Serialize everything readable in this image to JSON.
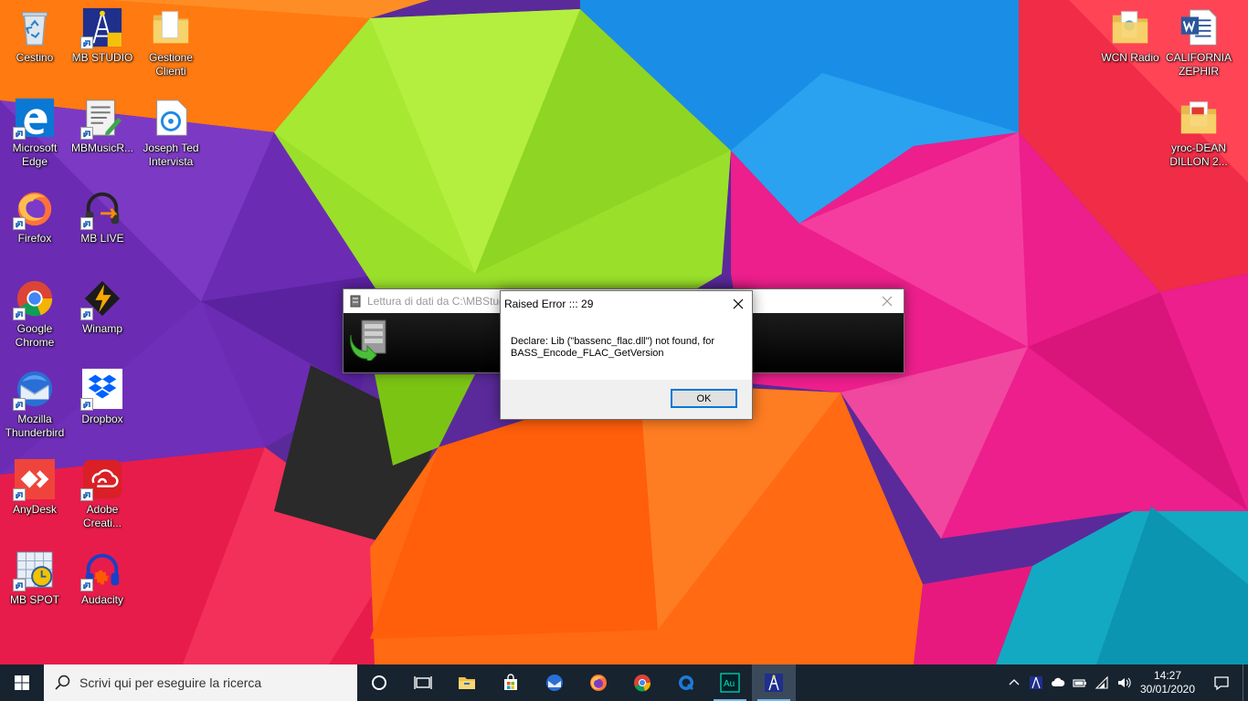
{
  "desktop": {
    "left_icons": [
      {
        "label": "Cestino",
        "icon": "recycle-bin-icon",
        "shortcut": false
      },
      {
        "label": "MB STUDIO",
        "icon": "mb-studio-icon",
        "shortcut": true
      },
      {
        "label": "Gestione Clienti",
        "icon": "folder-icon",
        "shortcut": false
      },
      {
        "label": "Microsoft Edge",
        "icon": "edge-icon",
        "shortcut": true
      },
      {
        "label": "MBMusicR...",
        "icon": "document-edit-icon",
        "shortcut": true
      },
      {
        "label": "Joseph Ted Intervista",
        "icon": "audio-file-icon",
        "shortcut": false
      },
      {
        "label": "Firefox",
        "icon": "firefox-icon",
        "shortcut": true
      },
      {
        "label": "MB LIVE",
        "icon": "headphones-icon",
        "shortcut": true
      },
      {
        "label": "Google Chrome",
        "icon": "chrome-icon",
        "shortcut": true
      },
      {
        "label": "Winamp",
        "icon": "winamp-icon",
        "shortcut": true
      },
      {
        "label": "Mozilla Thunderbird",
        "icon": "thunderbird-icon",
        "shortcut": true
      },
      {
        "label": "Dropbox",
        "icon": "dropbox-icon",
        "shortcut": true
      },
      {
        "label": "AnyDesk",
        "icon": "anydesk-icon",
        "shortcut": true
      },
      {
        "label": "Adobe Creati...",
        "icon": "adobe-cc-icon",
        "shortcut": true
      },
      {
        "label": "MB SPOT",
        "icon": "mb-spot-icon",
        "shortcut": true
      },
      {
        "label": "Audacity",
        "icon": "audacity-icon",
        "shortcut": true
      }
    ],
    "right_icons": [
      {
        "label": "WCN Radio",
        "icon": "folder-icon",
        "shortcut": false
      },
      {
        "label": "CALIFORNIA ZEPHIR",
        "icon": "word-doc-icon",
        "shortcut": false
      },
      {
        "label": "yroc-DEAN DILLON 2...",
        "icon": "pdf-folder-icon",
        "shortcut": false
      }
    ]
  },
  "progress_window": {
    "title": "Lettura di dati da C:\\MBStudio"
  },
  "error_dialog": {
    "title": "Raised Error ::: 29",
    "message": "Declare: Lib (\"bassenc_flac.dll\") not found, for BASS_Encode_FLAC_GetVersion",
    "ok_label": "OK"
  },
  "taskbar": {
    "search_placeholder": "Scrivi qui per eseguire la ricerca",
    "apps": [
      "cortana-icon",
      "task-view-icon",
      "file-explorer-icon",
      "store-icon",
      "thunderbird-icon",
      "firefox-icon",
      "chrome-icon",
      "q-app-icon",
      "audition-icon",
      "mb-studio-icon"
    ],
    "time": "14:27",
    "date": "30/01/2020"
  },
  "colors": {
    "taskbar": "#17232f",
    "accent": "#0078d7"
  }
}
